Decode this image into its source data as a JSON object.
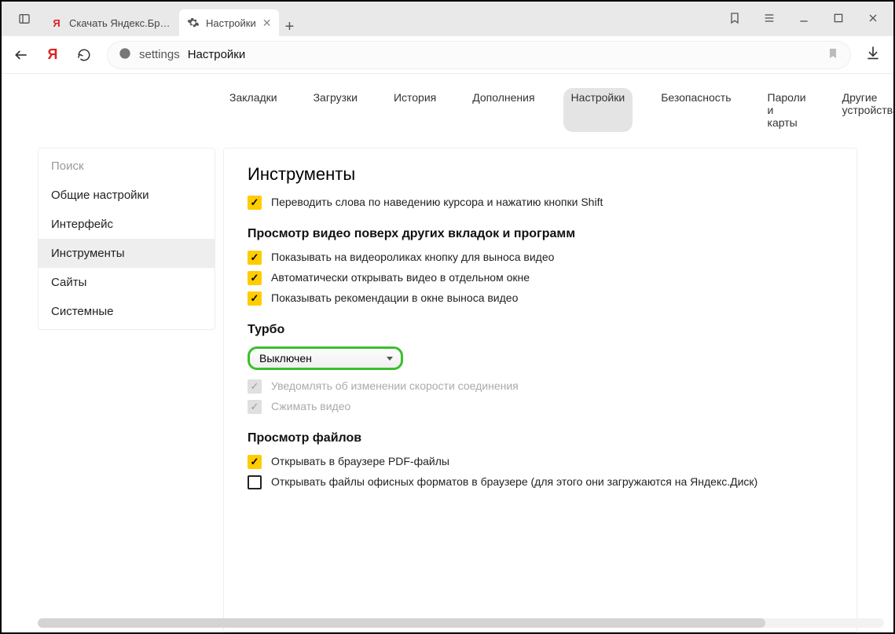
{
  "titlebar": {
    "tab1_label": "Скачать Яндекс.Браузер д",
    "tab2_label": "Настройки"
  },
  "addressbar": {
    "host": "settings",
    "title": "Настройки"
  },
  "topnav": {
    "bookmarks": "Закладки",
    "downloads": "Загрузки",
    "history": "История",
    "addons": "Дополнения",
    "settings": "Настройки",
    "security": "Безопасность",
    "passwords": "Пароли и карты",
    "other_devices": "Другие устройства"
  },
  "sidebar": {
    "search_placeholder": "Поиск",
    "general": "Общие настройки",
    "interface": "Интерфейс",
    "tools": "Инструменты",
    "sites": "Сайты",
    "system": "Системные"
  },
  "content": {
    "page_title": "Инструменты",
    "translate_shift": "Переводить слова по наведению курсора и нажатию кнопки Shift",
    "video_header": "Просмотр видео поверх других вкладок и программ",
    "video_button": "Показывать на видеороликах кнопку для выноса видео",
    "video_auto": "Автоматически открывать видео в отдельном окне",
    "video_recs": "Показывать рекомендации в окне выноса видео",
    "turbo_header": "Турбо",
    "turbo_value": "Выключен",
    "turbo_notify": "Уведомлять об изменении скорости соединения",
    "turbo_compress": "Сжимать видео",
    "files_header": "Просмотр файлов",
    "files_pdf": "Открывать в браузере PDF-файлы",
    "files_office": "Открывать файлы офисных форматов в браузере (для этого они загружаются на Яндекс.Диск)"
  }
}
